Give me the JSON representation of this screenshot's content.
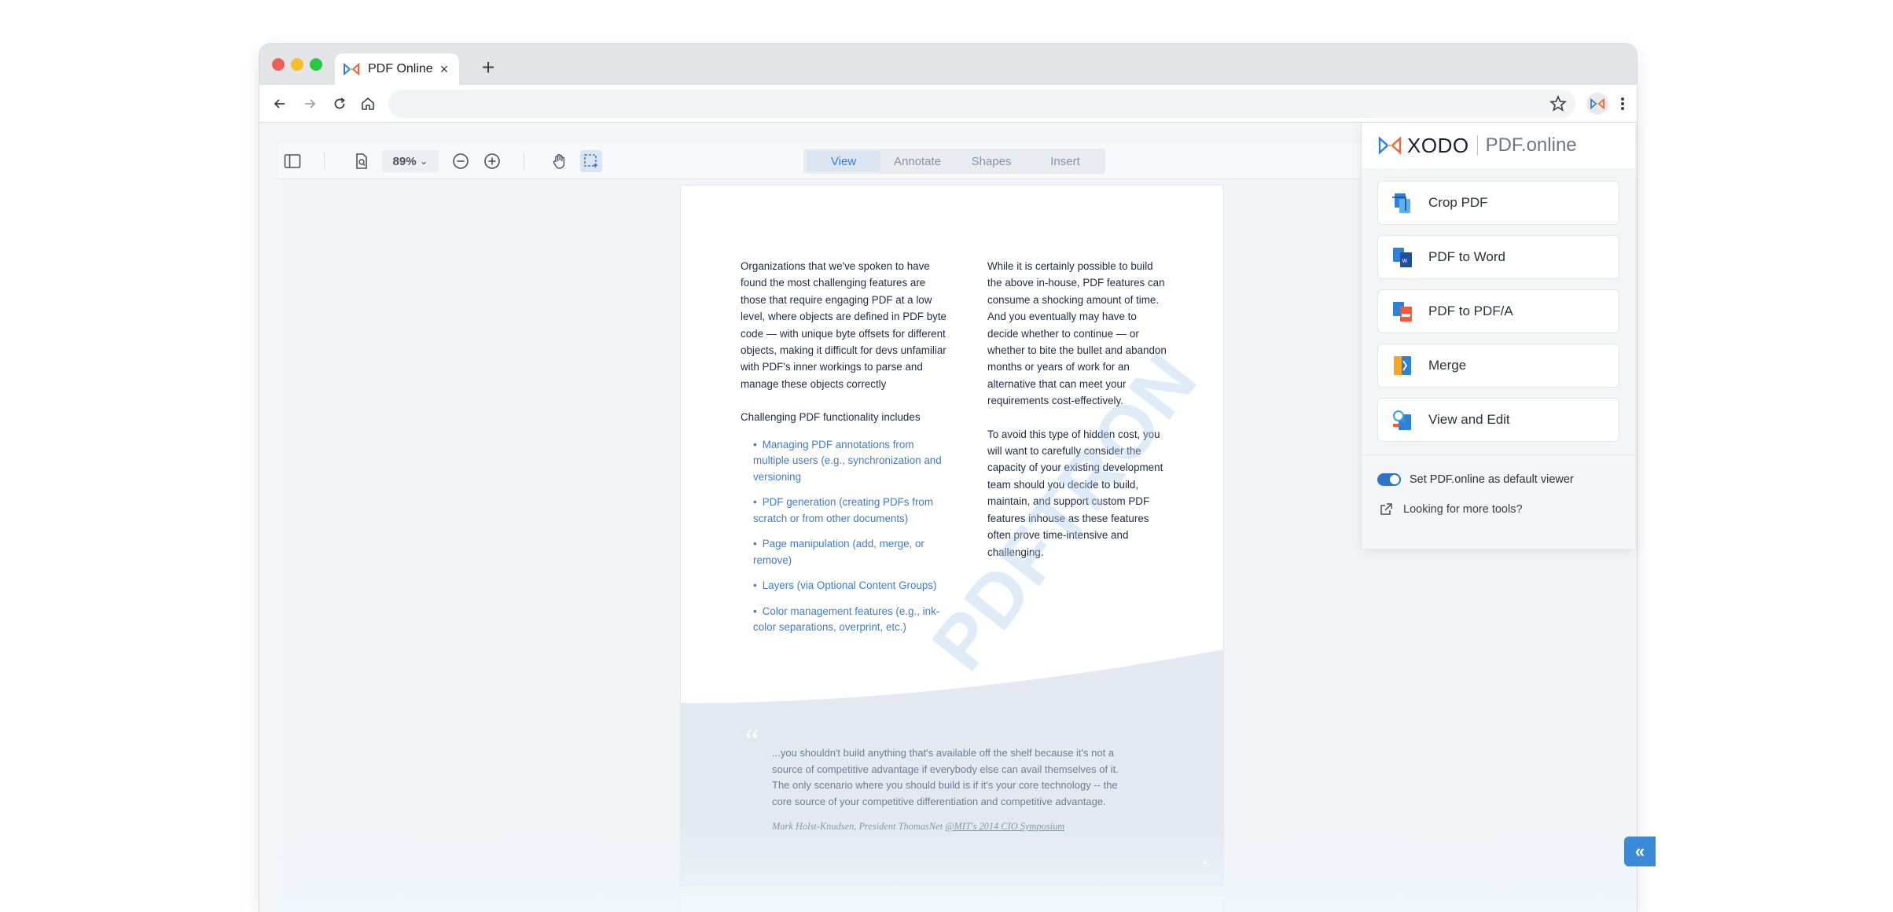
{
  "browser": {
    "tab_title": "PDF Online",
    "tab_close": "×",
    "new_tab": "+",
    "address_text": ""
  },
  "viewer": {
    "zoom": "89%",
    "zoom_chevron": "⌄",
    "modes": [
      "View",
      "Annotate",
      "Shapes",
      "Insert"
    ],
    "active_mode": "View"
  },
  "document": {
    "left_para": "Organizations that we've spoken to have found the most challenging features are those that require engaging PDF at a low level, where objects are defined in PDF byte code — with unique byte offsets for different objects, making it difficult for devs unfamiliar with PDF's inner workings to parse and manage these objects correctly",
    "list_intro": "Challenging PDF functionality includes",
    "bullets": [
      "Managing PDF annotations from multiple users (e.g., synchronization and versioning",
      "PDF generation (creating PDFs from scratch or from other documents)",
      "Page manipulation (add, merge, or remove)",
      "Layers (via Optional Content Groups)",
      "Color management features (e.g., ink-color separations, overprint, etc.)"
    ],
    "right_para_1": "While it is certainly possible to build the above in-house, PDF features can consume a shocking amount of time. And you eventually may have to decide whether to continue — or whether to bite the bullet and abandon months or years of work for an alternative that can meet your requirements cost-effectively.",
    "right_para_2": "To avoid this type of hidden cost, you will want to carefully consider the capacity of your existing development team should you decide to build, maintain, and support custom PDF features inhouse as these features often prove time-intensive and challenging.",
    "watermark": "PDFTRON",
    "quote_mark": "“",
    "quote": "...you shouldn't build anything that's available off the shelf because it's not a source of competitive advantage if everybody else can avail themselves of it. The only scenario where you should build is if it's your core technology -- the core source of your competitive differentiation and competitive advantage.",
    "attribution_name": "Mark Holst-Knudsen, President ThomasNet ",
    "attribution_event": "@MIT's 2014 CIO Symposium",
    "page_number": "5"
  },
  "extension": {
    "brand_xodo": "XODO",
    "brand_pdf": "PDF.online",
    "tools": [
      {
        "label": "Crop PDF",
        "icon": "crop-pdf-icon"
      },
      {
        "label": "PDF to Word",
        "icon": "pdf-to-word-icon"
      },
      {
        "label": "PDF to PDF/A",
        "icon": "pdf-to-pdfa-icon"
      },
      {
        "label": "Merge",
        "icon": "merge-icon"
      },
      {
        "label": "View and Edit",
        "icon": "view-edit-icon"
      }
    ],
    "default_viewer_label": "Set PDF.online as default viewer",
    "default_viewer_enabled": true,
    "more_tools_label": "Looking for more tools?"
  },
  "collapse_label": "«",
  "colors": {
    "accent": "#2f80d9",
    "toggle": "#2b74c8",
    "collapse_button": "#3b8ad8",
    "link_text": "#3d7cc6"
  }
}
